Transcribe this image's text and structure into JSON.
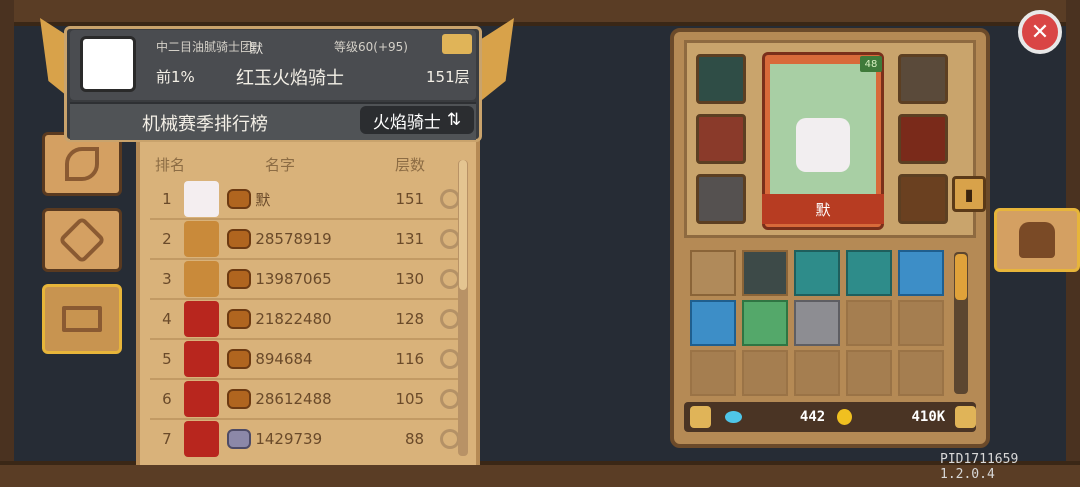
{
  "profile": {
    "guild": "中二目油腻骑士团",
    "name": "默",
    "level_label": "等级60(+95)",
    "rank_percent": "前1%",
    "hero_title": "红玉火焰骑士",
    "floor": "151层",
    "leaderboard_title": "机械赛季排行榜",
    "switch_label": "火焰骑士"
  },
  "leaderboard": {
    "headers": {
      "rank": "排名",
      "name": "名字",
      "floor": "层数"
    },
    "rows": [
      {
        "rank": "1",
        "name": "默",
        "floor": "151",
        "crest": "red",
        "avatar": "white"
      },
      {
        "rank": "2",
        "name": "28578919",
        "floor": "131",
        "crest": "orange",
        "avatar": "gold"
      },
      {
        "rank": "3",
        "name": "13987065",
        "floor": "130",
        "crest": "orange",
        "avatar": "gold"
      },
      {
        "rank": "4",
        "name": "21822480",
        "floor": "128",
        "crest": "orange",
        "avatar": "red"
      },
      {
        "rank": "5",
        "name": "894684",
        "floor": "116",
        "crest": "orange",
        "avatar": "red"
      },
      {
        "rank": "6",
        "name": "28612488",
        "floor": "105",
        "crest": "orange",
        "avatar": "red"
      },
      {
        "rank": "7",
        "name": "1429739",
        "floor": "88",
        "crest": "silver",
        "avatar": "red"
      }
    ]
  },
  "equipment": {
    "hero_name": "默",
    "hero_level": "48"
  },
  "currency": {
    "gems": "442",
    "coins": "410K"
  },
  "version": "PID1711659 1.2.0.4",
  "colors": {
    "wood": "#5a3d25",
    "panel": "#d9b27a",
    "accent_gold": "#e7b53a",
    "close_red": "#d94545"
  }
}
